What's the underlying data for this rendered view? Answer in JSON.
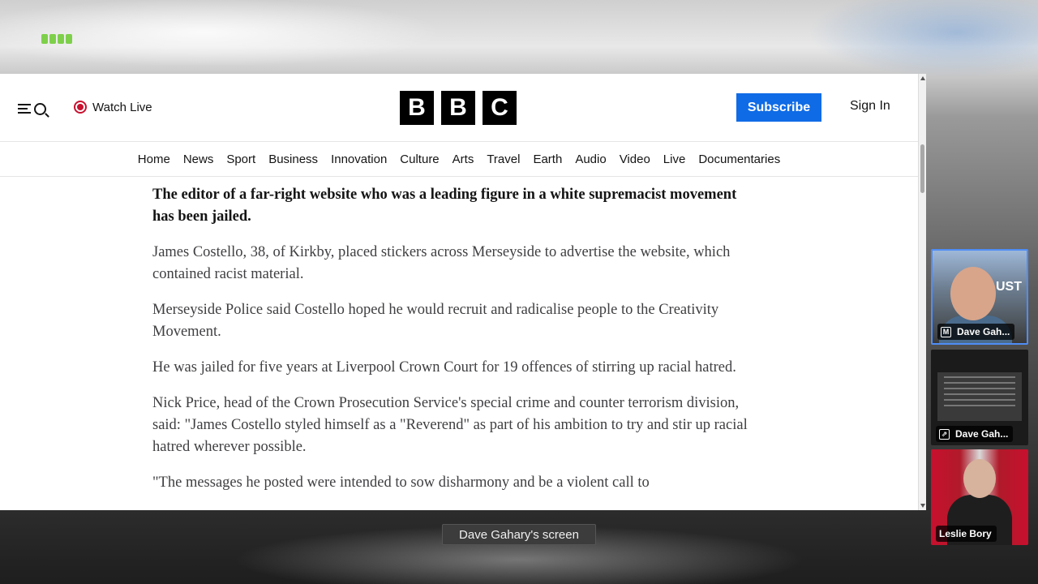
{
  "browser": {
    "header": {
      "watch_live": "Watch Live",
      "logo_letters": [
        "B",
        "B",
        "C"
      ],
      "subscribe": "Subscribe",
      "sign_in": "Sign In"
    },
    "nav": [
      "Home",
      "News",
      "Sport",
      "Business",
      "Innovation",
      "Culture",
      "Arts",
      "Travel",
      "Earth",
      "Audio",
      "Video",
      "Live",
      "Documentaries"
    ],
    "article": {
      "lead": "The editor of a far-right website who was a leading figure in a white supremacist movement has been jailed.",
      "paragraphs": [
        "James Costello, 38, of Kirkby, placed stickers across Merseyside to advertise the website, which contained racist material.",
        "Merseyside Police said Costello hoped he would recruit and radicalise people to the Creativity Movement.",
        "He was jailed for five years at Liverpool Crown Court for 19 offences of stirring up racial hatred.",
        "Nick Price, head of the Crown Prosecution Service's special crime and counter terrorism division, said: \"James Costello styled himself as a \"Reverend\" as part of his ambition to try and stir up racial hatred wherever possible.",
        "\"The messages he posted were intended to sow disharmony and be a violent call to"
      ]
    }
  },
  "meeting": {
    "screen_caption": "Dave Gahary's screen",
    "participants": [
      {
        "name": "Dave Gah...",
        "badge": "M"
      },
      {
        "name": "Dave Gah...",
        "badge": "share-icon"
      },
      {
        "name": "Leslie Bory"
      }
    ],
    "tile_sign_text": "UST"
  },
  "colors": {
    "bbc_blue": "#0f6be6",
    "live_red": "#c8102e",
    "active_speaker": "#4f8df5"
  }
}
